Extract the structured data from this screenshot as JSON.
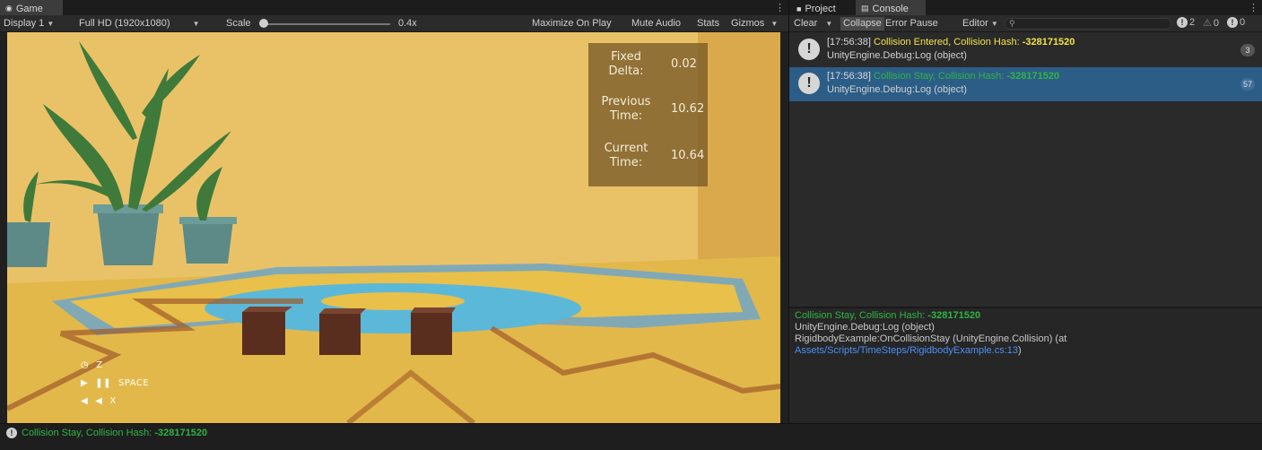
{
  "game_panel": {
    "tab_label": "Game",
    "toolbar": {
      "display": "Display 1",
      "resolution": "Full HD (1920x1080)",
      "scale_label": "Scale",
      "scale_value": "0.4x",
      "maximize_on_play": "Maximize On Play",
      "mute_audio": "Mute Audio",
      "stats": "Stats",
      "gizmos": "Gizmos"
    },
    "overlay": {
      "fixed_delta_label": "Fixed Delta:",
      "fixed_delta_value": "0.02",
      "previous_time_label": "Previous Time:",
      "previous_time_value": "10.62",
      "current_time_label": "Current Time:",
      "current_time_value": "10.64"
    },
    "controls": {
      "row1_key": "Z",
      "row2_key": "SPACE",
      "row3_key": "X"
    },
    "scene_colors": {
      "wall": "#e9c268",
      "floor": "#e8c04a",
      "pool": "#5cb8d8",
      "cube": "#5a2e1e"
    }
  },
  "console_panel": {
    "tabs": {
      "project": "Project",
      "console": "Console"
    },
    "toolbar": {
      "clear": "Clear",
      "collapse": "Collapse",
      "error_pause": "Error Pause",
      "editor": "Editor",
      "search_placeholder": "",
      "log_count": "2",
      "warning_count": "0",
      "error_count": "0"
    },
    "entries": [
      {
        "timestamp": "[17:56:38]",
        "message": "Collision Entered, Collision Hash: ",
        "hash": "-328171520",
        "source": "UnityEngine.Debug:Log (object)",
        "count": "3"
      },
      {
        "timestamp": "[17:56:38]",
        "message": "Collision Stay, Collision Hash: ",
        "hash": "-328171520",
        "source": "UnityEngine.Debug:Log (object)",
        "count": "57"
      }
    ],
    "detail": {
      "line1_message": "Collision Stay, Collision Hash: ",
      "line1_hash": "-328171520",
      "line2": "UnityEngine.Debug:Log (object)",
      "line3": "RigidbodyExample:OnCollisionStay (UnityEngine.Collision) (at",
      "line4_link": "Assets/Scripts/TimeSteps/RigidbodyExample.cs:13",
      "line4_tail": ")"
    }
  },
  "status_bar": {
    "message": "Collision Stay, Collision Hash: ",
    "hash": "-328171520"
  }
}
